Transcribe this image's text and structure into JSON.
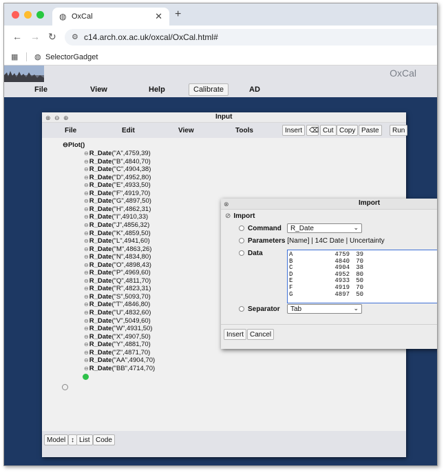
{
  "browser": {
    "tab_title": "OxCal",
    "url": "c14.arch.ox.ac.uk/oxcal/OxCal.html#",
    "bookmark": "SelectorGadget"
  },
  "app": {
    "title": "OxCal",
    "menu": {
      "file": "File",
      "view": "View",
      "help": "Help",
      "calibrate": "Calibrate",
      "ad": "AD"
    }
  },
  "input_window": {
    "title": "Input",
    "menu": {
      "file": "File",
      "edit": "Edit",
      "view": "View",
      "tools": "Tools"
    },
    "toolbar": {
      "insert": "Insert",
      "cut": "Cut",
      "copy": "Copy",
      "paste": "Paste",
      "run": "Run"
    },
    "plot_label": "Plot()",
    "entries": [
      {
        "fn": "R_Date",
        "args": "(\"A\",4759,39)"
      },
      {
        "fn": "R_Date",
        "args": "(\"B\",4840,70)"
      },
      {
        "fn": "R_Date",
        "args": "(\"C\",4904,38)"
      },
      {
        "fn": "R_Date",
        "args": "(\"D\",4952,80)"
      },
      {
        "fn": "R_Date",
        "args": "(\"E\",4933,50)"
      },
      {
        "fn": "R_Date",
        "args": "(\"F\",4919,70)"
      },
      {
        "fn": "R_Date",
        "args": "(\"G\",4897,50)"
      },
      {
        "fn": "R_Date",
        "args": "(\"H\",4862,31)"
      },
      {
        "fn": "R_Date",
        "args": "(\"I\",4910,33)"
      },
      {
        "fn": "R_Date",
        "args": "(\"J\",4856,32)"
      },
      {
        "fn": "R_Date",
        "args": "(\"K\",4859,50)"
      },
      {
        "fn": "R_Date",
        "args": "(\"L\",4941,60)"
      },
      {
        "fn": "R_Date",
        "args": "(\"M\",4863,26)"
      },
      {
        "fn": "R_Date",
        "args": "(\"N\",4834,80)"
      },
      {
        "fn": "R_Date",
        "args": "(\"O\",4898,43)"
      },
      {
        "fn": "R_Date",
        "args": "(\"P\",4969,60)"
      },
      {
        "fn": "R_Date",
        "args": "(\"Q\",4811,70)"
      },
      {
        "fn": "R_Date",
        "args": "(\"R\",4823,31)"
      },
      {
        "fn": "R_Date",
        "args": "(\"S\",5093,70)"
      },
      {
        "fn": "R_Date",
        "args": "(\"T\",4846,80)"
      },
      {
        "fn": "R_Date",
        "args": "(\"U\",4832,60)"
      },
      {
        "fn": "R_Date",
        "args": "(\"V\",5049,60)"
      },
      {
        "fn": "R_Date",
        "args": "(\"W\",4931,50)"
      },
      {
        "fn": "R_Date",
        "args": "(\"X\",4907,50)"
      },
      {
        "fn": "R_Date",
        "args": "(\"Y\",4881,70)"
      },
      {
        "fn": "R_Date",
        "args": "(\"Z\",4871,70)"
      },
      {
        "fn": "R_Date",
        "args": "(\"AA\",4904,70)"
      },
      {
        "fn": "R_Date",
        "args": "(\"BB\",4714,70)"
      }
    ],
    "bottom_tabs": {
      "model": "Model",
      "sort": "↕",
      "list": "List",
      "code": "Code"
    }
  },
  "import_window": {
    "title": "Import",
    "section": "Import",
    "command_label": "Command",
    "command_value": "R_Date",
    "parameters_label": "Parameters",
    "parameters_value": "[Name] | 14C Date | Uncertainty",
    "data_label": "Data",
    "data_rows": [
      [
        "A",
        "4759",
        "39"
      ],
      [
        "B",
        "4840",
        "70"
      ],
      [
        "C",
        "4904",
        "38"
      ],
      [
        "D",
        "4952",
        "80"
      ],
      [
        "E",
        "4933",
        "50"
      ],
      [
        "F",
        "4919",
        "70"
      ],
      [
        "G",
        "4897",
        "50"
      ]
    ],
    "separator_label": "Separator",
    "separator_value": "Tab",
    "insert": "Insert",
    "cancel": "Cancel"
  },
  "colors": {
    "desktop": "#1d3863",
    "accent_green": "#2ec14a"
  }
}
